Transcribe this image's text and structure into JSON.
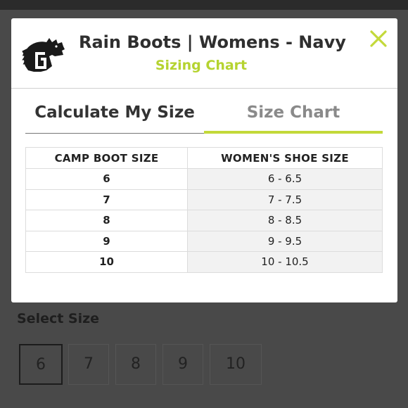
{
  "modal": {
    "title": "Rain Boots | Womens - Navy",
    "subtitle": "Sizing Chart",
    "close_icon": "close-icon",
    "accent_color": "#c3d93a"
  },
  "tabs": [
    {
      "label": "Calculate My Size",
      "active": false
    },
    {
      "label": "Size Chart",
      "active": true
    }
  ],
  "size_table": {
    "headers": [
      "CAMP BOOT SIZE",
      "WOMEN'S SHOE SIZE"
    ],
    "rows": [
      {
        "boot": "6",
        "shoe": "6 - 6.5"
      },
      {
        "boot": "7",
        "shoe": "7 - 7.5"
      },
      {
        "boot": "8",
        "shoe": "8 - 8.5"
      },
      {
        "boot": "9",
        "shoe": "9 - 9.5"
      },
      {
        "boot": "10",
        "shoe": "10 - 10.5"
      }
    ]
  },
  "background": {
    "select_label": "Select Size",
    "sizes": [
      "6",
      "7",
      "8",
      "9",
      "10"
    ],
    "selected_size": "6"
  }
}
